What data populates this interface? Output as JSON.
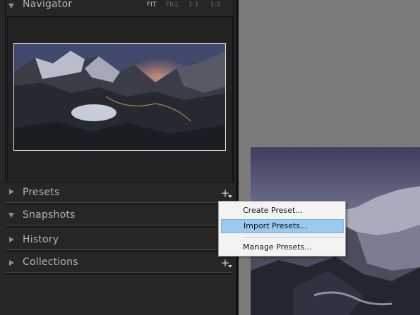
{
  "navigator": {
    "title": "Navigator",
    "zoom_options": [
      "FIT",
      "FILL",
      "1:1",
      "1:2"
    ],
    "active_zoom": "FIT"
  },
  "panels": {
    "presets": "Presets",
    "snapshots": "Snapshots",
    "history": "History",
    "collections": "Collections"
  },
  "context_menu": {
    "items": [
      "Create Preset...",
      "Import Presets...",
      "Manage Presets..."
    ],
    "highlighted": "Import Presets..."
  },
  "icons": {
    "add_preset": "plus-icon",
    "add_collection": "plus-icon"
  },
  "colors": {
    "panel_bg": "#262626",
    "canvas_bg": "#7b7b7b",
    "menu_highlight": "#99c9ef"
  }
}
